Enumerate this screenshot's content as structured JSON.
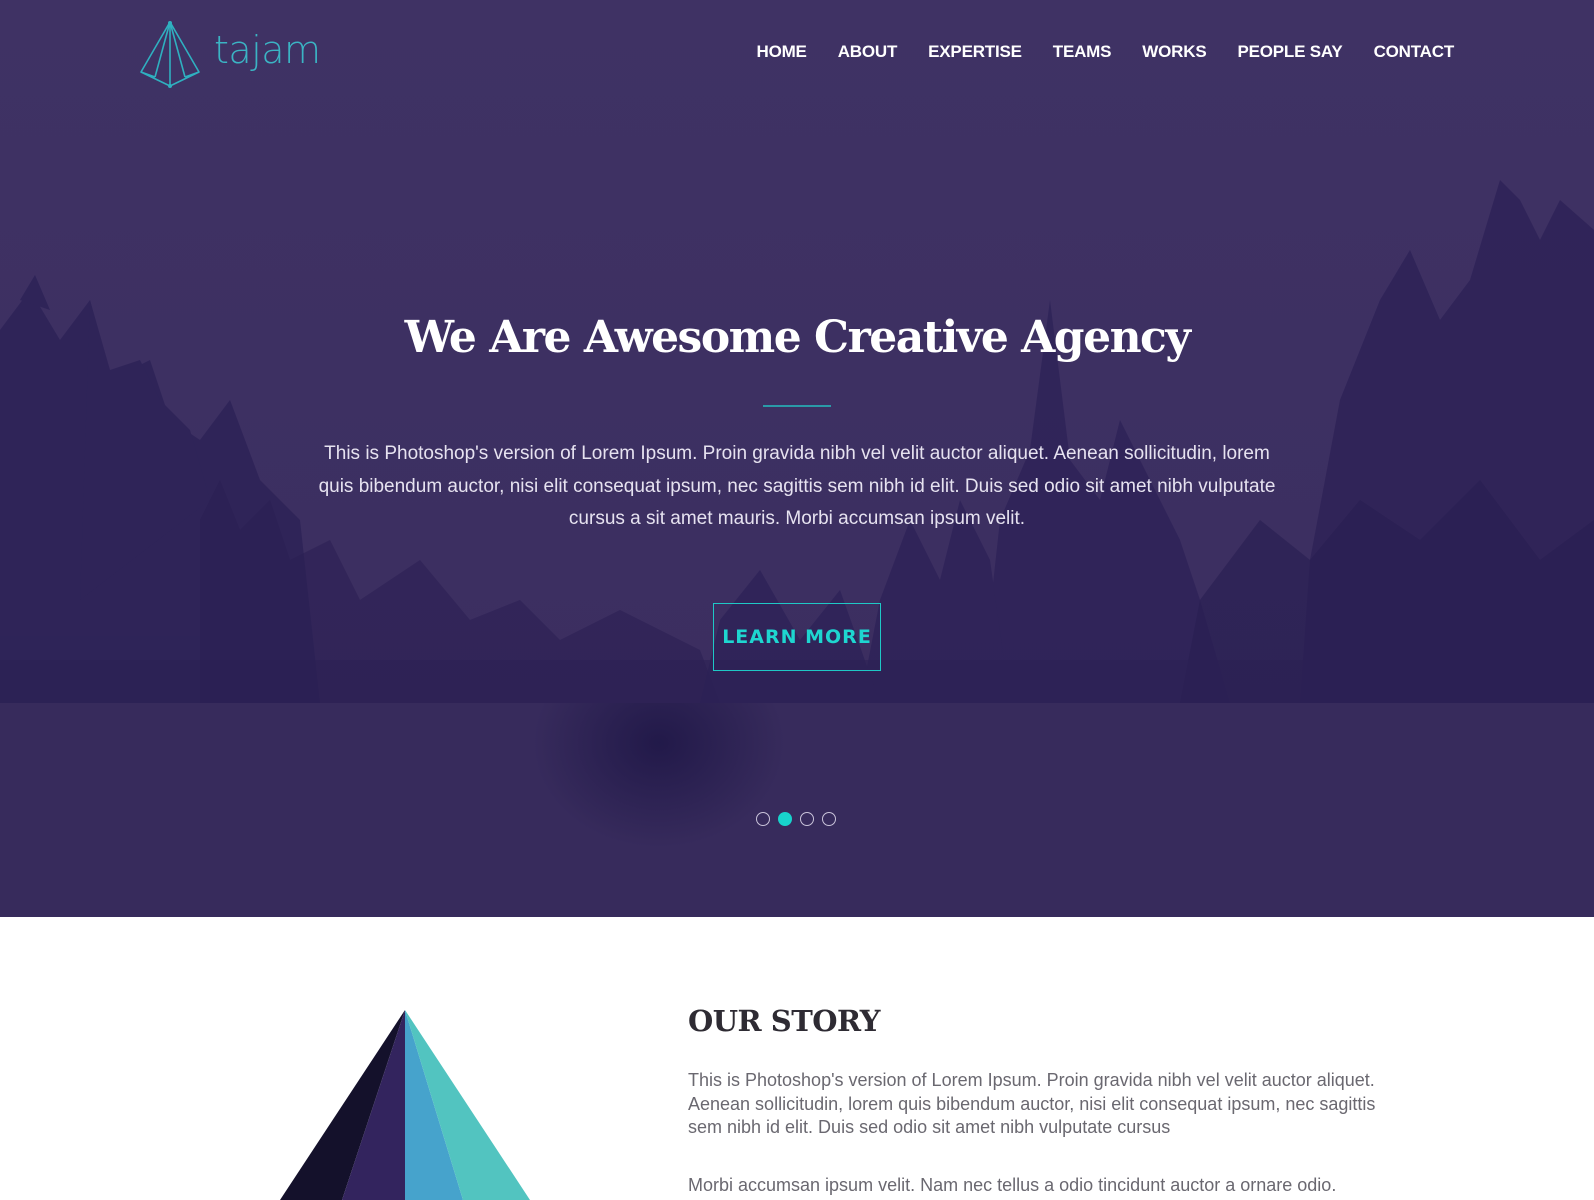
{
  "brand": {
    "name": "tajam",
    "logo_icon": "paper-pyramid-icon",
    "accent_color": "#1ed6d0"
  },
  "nav": {
    "items": [
      {
        "label": "HOME"
      },
      {
        "label": "ABOUT"
      },
      {
        "label": "EXPERTISE"
      },
      {
        "label": "TEAMS"
      },
      {
        "label": "WORKS"
      },
      {
        "label": "PEOPLE SAY"
      },
      {
        "label": "CONTACT"
      }
    ]
  },
  "hero": {
    "title": "We Are Awesome Creative Agency",
    "text": "This is Photoshop's version of Lorem Ipsum. Proin gravida nibh vel velit auctor aliquet. Aenean sollicitudin, lorem quis bibendum auctor, nisi elit consequat ipsum, nec sagittis sem nibh id elit. Duis sed odio sit amet nibh vulputate cursus a sit amet mauris. Morbi accumsan ipsum velit.",
    "cta_label": "LEARN MORE",
    "slider": {
      "total_slides": 4,
      "active_slide": 2
    },
    "background_color": "#3d3062"
  },
  "story": {
    "title": "OUR STORY",
    "paragraphs": [
      "This is Photoshop's version of Lorem Ipsum. Proin gravida nibh vel velit auctor aliquet. Aenean sollicitudin, lorem quis bibendum auctor, nisi elit consequat ipsum, nec sagittis sem nibh id elit. Duis sed odio sit amet nibh vulputate cursus",
      "Morbi accumsan ipsum velit. Nam nec tellus a odio tincidunt auctor a ornare odio."
    ],
    "illustration": "pyramid-illustration",
    "illustration_colors": [
      "#14112b",
      "#33245e",
      "#46a3cc",
      "#52c4c0"
    ]
  }
}
